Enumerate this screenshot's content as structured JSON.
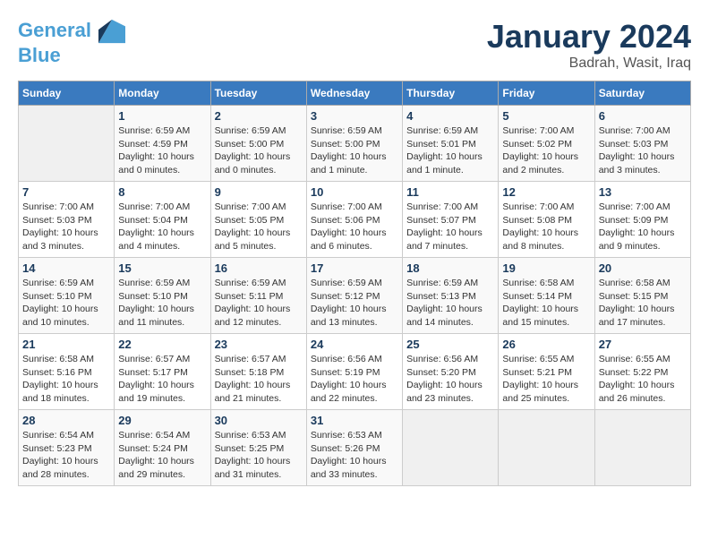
{
  "header": {
    "logo_line1": "General",
    "logo_line2": "Blue",
    "title": "January 2024",
    "subtitle": "Badrah, Wasit, Iraq"
  },
  "calendar": {
    "days_of_week": [
      "Sunday",
      "Monday",
      "Tuesday",
      "Wednesday",
      "Thursday",
      "Friday",
      "Saturday"
    ],
    "weeks": [
      [
        {
          "day": "",
          "info": ""
        },
        {
          "day": "1",
          "info": "Sunrise: 6:59 AM\nSunset: 4:59 PM\nDaylight: 10 hours\nand 0 minutes."
        },
        {
          "day": "2",
          "info": "Sunrise: 6:59 AM\nSunset: 5:00 PM\nDaylight: 10 hours\nand 0 minutes."
        },
        {
          "day": "3",
          "info": "Sunrise: 6:59 AM\nSunset: 5:00 PM\nDaylight: 10 hours\nand 1 minute."
        },
        {
          "day": "4",
          "info": "Sunrise: 6:59 AM\nSunset: 5:01 PM\nDaylight: 10 hours\nand 1 minute."
        },
        {
          "day": "5",
          "info": "Sunrise: 7:00 AM\nSunset: 5:02 PM\nDaylight: 10 hours\nand 2 minutes."
        },
        {
          "day": "6",
          "info": "Sunrise: 7:00 AM\nSunset: 5:03 PM\nDaylight: 10 hours\nand 3 minutes."
        }
      ],
      [
        {
          "day": "7",
          "info": "Sunrise: 7:00 AM\nSunset: 5:03 PM\nDaylight: 10 hours\nand 3 minutes."
        },
        {
          "day": "8",
          "info": "Sunrise: 7:00 AM\nSunset: 5:04 PM\nDaylight: 10 hours\nand 4 minutes."
        },
        {
          "day": "9",
          "info": "Sunrise: 7:00 AM\nSunset: 5:05 PM\nDaylight: 10 hours\nand 5 minutes."
        },
        {
          "day": "10",
          "info": "Sunrise: 7:00 AM\nSunset: 5:06 PM\nDaylight: 10 hours\nand 6 minutes."
        },
        {
          "day": "11",
          "info": "Sunrise: 7:00 AM\nSunset: 5:07 PM\nDaylight: 10 hours\nand 7 minutes."
        },
        {
          "day": "12",
          "info": "Sunrise: 7:00 AM\nSunset: 5:08 PM\nDaylight: 10 hours\nand 8 minutes."
        },
        {
          "day": "13",
          "info": "Sunrise: 7:00 AM\nSunset: 5:09 PM\nDaylight: 10 hours\nand 9 minutes."
        }
      ],
      [
        {
          "day": "14",
          "info": "Sunrise: 6:59 AM\nSunset: 5:10 PM\nDaylight: 10 hours\nand 10 minutes."
        },
        {
          "day": "15",
          "info": "Sunrise: 6:59 AM\nSunset: 5:10 PM\nDaylight: 10 hours\nand 11 minutes."
        },
        {
          "day": "16",
          "info": "Sunrise: 6:59 AM\nSunset: 5:11 PM\nDaylight: 10 hours\nand 12 minutes."
        },
        {
          "day": "17",
          "info": "Sunrise: 6:59 AM\nSunset: 5:12 PM\nDaylight: 10 hours\nand 13 minutes."
        },
        {
          "day": "18",
          "info": "Sunrise: 6:59 AM\nSunset: 5:13 PM\nDaylight: 10 hours\nand 14 minutes."
        },
        {
          "day": "19",
          "info": "Sunrise: 6:58 AM\nSunset: 5:14 PM\nDaylight: 10 hours\nand 15 minutes."
        },
        {
          "day": "20",
          "info": "Sunrise: 6:58 AM\nSunset: 5:15 PM\nDaylight: 10 hours\nand 17 minutes."
        }
      ],
      [
        {
          "day": "21",
          "info": "Sunrise: 6:58 AM\nSunset: 5:16 PM\nDaylight: 10 hours\nand 18 minutes."
        },
        {
          "day": "22",
          "info": "Sunrise: 6:57 AM\nSunset: 5:17 PM\nDaylight: 10 hours\nand 19 minutes."
        },
        {
          "day": "23",
          "info": "Sunrise: 6:57 AM\nSunset: 5:18 PM\nDaylight: 10 hours\nand 21 minutes."
        },
        {
          "day": "24",
          "info": "Sunrise: 6:56 AM\nSunset: 5:19 PM\nDaylight: 10 hours\nand 22 minutes."
        },
        {
          "day": "25",
          "info": "Sunrise: 6:56 AM\nSunset: 5:20 PM\nDaylight: 10 hours\nand 23 minutes."
        },
        {
          "day": "26",
          "info": "Sunrise: 6:55 AM\nSunset: 5:21 PM\nDaylight: 10 hours\nand 25 minutes."
        },
        {
          "day": "27",
          "info": "Sunrise: 6:55 AM\nSunset: 5:22 PM\nDaylight: 10 hours\nand 26 minutes."
        }
      ],
      [
        {
          "day": "28",
          "info": "Sunrise: 6:54 AM\nSunset: 5:23 PM\nDaylight: 10 hours\nand 28 minutes."
        },
        {
          "day": "29",
          "info": "Sunrise: 6:54 AM\nSunset: 5:24 PM\nDaylight: 10 hours\nand 29 minutes."
        },
        {
          "day": "30",
          "info": "Sunrise: 6:53 AM\nSunset: 5:25 PM\nDaylight: 10 hours\nand 31 minutes."
        },
        {
          "day": "31",
          "info": "Sunrise: 6:53 AM\nSunset: 5:26 PM\nDaylight: 10 hours\nand 33 minutes."
        },
        {
          "day": "",
          "info": ""
        },
        {
          "day": "",
          "info": ""
        },
        {
          "day": "",
          "info": ""
        }
      ]
    ]
  }
}
